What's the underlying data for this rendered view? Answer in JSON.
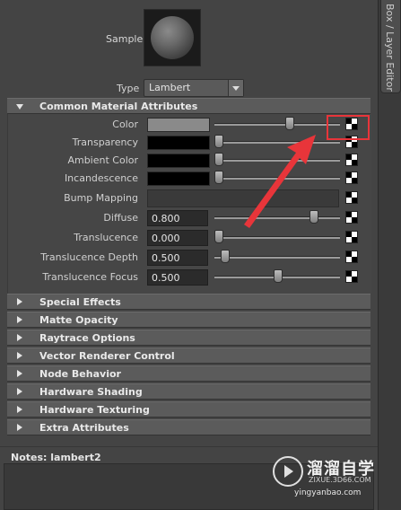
{
  "side_tab": {
    "label": "Box / Layer Editor"
  },
  "sample": {
    "label": "Sample"
  },
  "type": {
    "label": "Type",
    "value": "Lambert"
  },
  "common": {
    "title": "Common Material Attributes",
    "rows": [
      {
        "label": "Color",
        "kind": "color",
        "swatch": "#8a8a8a",
        "slider": 0.6
      },
      {
        "label": "Transparency",
        "kind": "color",
        "swatch": "#000000",
        "slider": 0.0
      },
      {
        "label": "Ambient Color",
        "kind": "color",
        "swatch": "#000000",
        "slider": 0.0
      },
      {
        "label": "Incandescence",
        "kind": "color",
        "swatch": "#000000",
        "slider": 0.0
      },
      {
        "label": "Bump Mapping",
        "kind": "bump"
      },
      {
        "label": "Diffuse",
        "kind": "number",
        "value": "0.800",
        "slider": 0.8
      },
      {
        "label": "Translucence",
        "kind": "number",
        "value": "0.000",
        "slider": 0.0
      },
      {
        "label": "Translucence Depth",
        "kind": "number",
        "value": "0.500",
        "slider": 0.05
      },
      {
        "label": "Translucence Focus",
        "kind": "number",
        "value": "0.500",
        "slider": 0.5
      }
    ]
  },
  "sections": [
    "Special Effects",
    "Matte Opacity",
    "Raytrace Options",
    "Vector Renderer Control",
    "Node Behavior",
    "Hardware Shading",
    "Hardware Texturing",
    "Extra Attributes"
  ],
  "notes": {
    "label": "Notes:",
    "value": "lambert2"
  },
  "watermark": {
    "brand": "溜溜自学",
    "url": "ZIXUE.3D66.COM",
    "url2": "yingyanbao.com"
  },
  "annotation_color": "#e8353a"
}
